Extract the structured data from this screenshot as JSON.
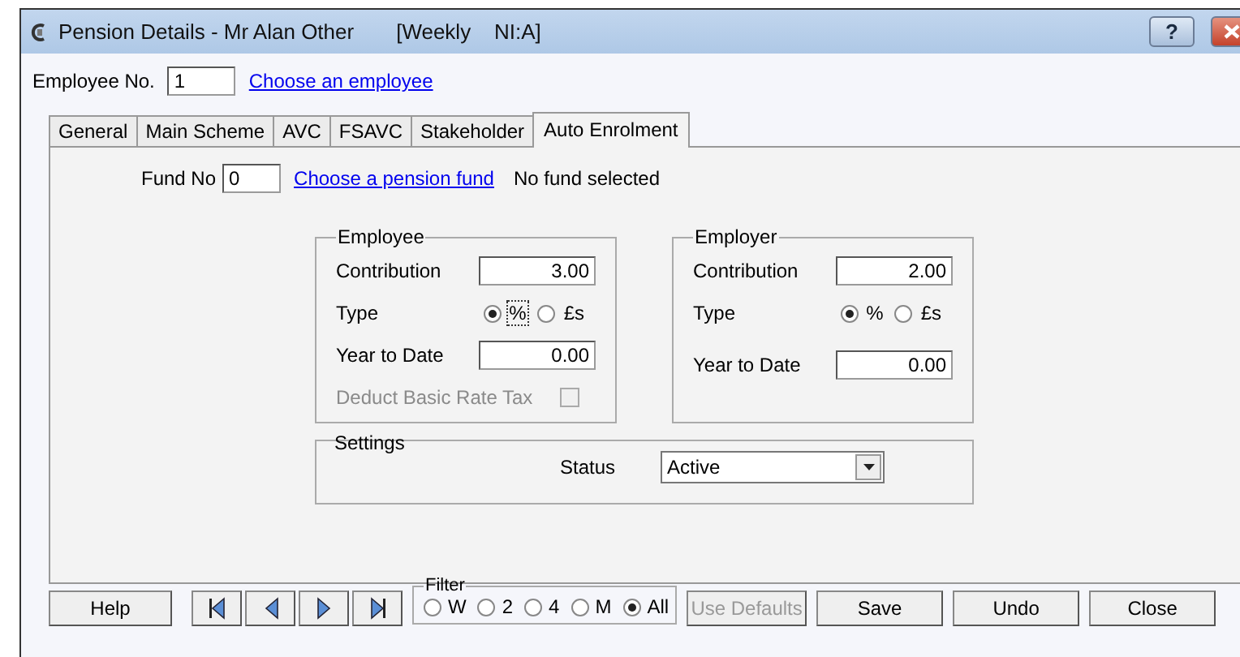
{
  "window": {
    "title": "Pension Details - Mr Alan Other",
    "subtitle": "[Weekly    NI:A]",
    "help_button": "?"
  },
  "employee": {
    "label": "Employee No.",
    "value": "1",
    "link": "Choose an employee"
  },
  "tabs": [
    {
      "label": "General",
      "selected": false
    },
    {
      "label": "Main Scheme",
      "selected": false
    },
    {
      "label": "AVC",
      "selected": false
    },
    {
      "label": "FSAVC",
      "selected": false
    },
    {
      "label": "Stakeholder",
      "selected": false
    },
    {
      "label": "Auto Enrolment",
      "selected": true
    }
  ],
  "fund": {
    "label": "Fund No",
    "value": "0",
    "link": "Choose a pension fund",
    "status": "No fund selected"
  },
  "groups": [
    {
      "title": "Employee",
      "contribution_label": "Contribution",
      "contribution": "3.00",
      "type_label": "Type",
      "type_options": [
        {
          "label": "%",
          "selected": true,
          "focused": true
        },
        {
          "label": "£s",
          "selected": false,
          "focused": false
        }
      ],
      "ytd_label": "Year to Date",
      "ytd": "0.00",
      "deduct": {
        "label": "Deduct Basic Rate Tax",
        "checked": false,
        "disabled": true
      }
    },
    {
      "title": "Employer",
      "contribution_label": "Contribution",
      "contribution": "2.00",
      "type_label": "Type",
      "type_options": [
        {
          "label": "%",
          "selected": true,
          "focused": false
        },
        {
          "label": "£s",
          "selected": false,
          "focused": false
        }
      ],
      "ytd_label": "Year to Date",
      "ytd": "0.00"
    }
  ],
  "settings": {
    "title": "Settings",
    "status_label": "Status",
    "status": "Active"
  },
  "help": "Help",
  "nav": [
    {
      "kind": "first"
    },
    {
      "kind": "prev"
    },
    {
      "kind": "next"
    },
    {
      "kind": "last"
    }
  ],
  "filter": {
    "title": "Filter",
    "options": [
      {
        "label": "W",
        "selected": false
      },
      {
        "label": "2",
        "selected": false
      },
      {
        "label": "4",
        "selected": false
      },
      {
        "label": "M",
        "selected": false
      },
      {
        "label": "All",
        "selected": true
      }
    ]
  },
  "actions": [
    {
      "label": "Use Defaults",
      "disabled": true
    },
    {
      "label": "Save",
      "disabled": false
    },
    {
      "label": "Undo",
      "disabled": false
    },
    {
      "label": "Close",
      "disabled": false
    }
  ]
}
